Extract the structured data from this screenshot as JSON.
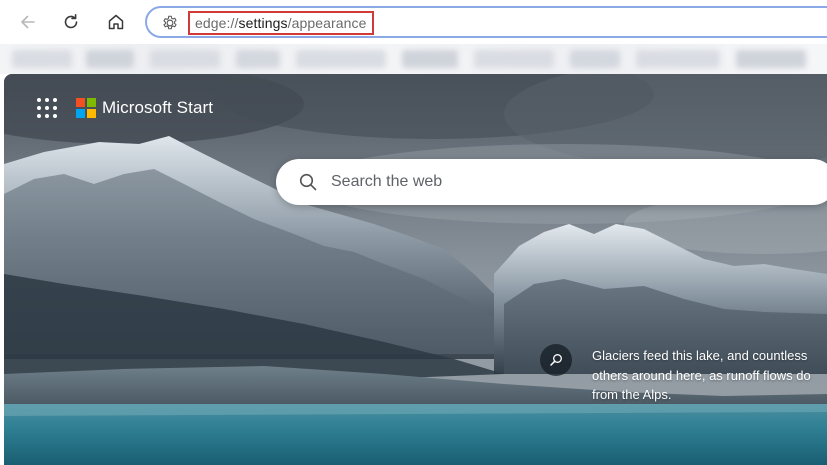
{
  "toolbar": {
    "address": {
      "scheme": "edge://",
      "host": "settings",
      "path": "/appearance"
    }
  },
  "ntp": {
    "brand": "Microsoft Start",
    "search_placeholder": "Search the web",
    "caption_lines": [
      "Glaciers feed this lake, and countless",
      "others around here, as runoff flows do",
      "from the Alps."
    ]
  },
  "colors": {
    "address_focus": "#8aa9e6",
    "url_highlight": "#d23a3a",
    "ms_red": "#f25022",
    "ms_green": "#7fba00",
    "ms_blue": "#00a4ef",
    "ms_yellow": "#ffb900"
  },
  "icons": [
    "back-arrow-icon",
    "refresh-icon",
    "home-icon",
    "gear-icon",
    "app-launcher-icon",
    "microsoft-logo",
    "search-icon",
    "image-search-icon"
  ]
}
